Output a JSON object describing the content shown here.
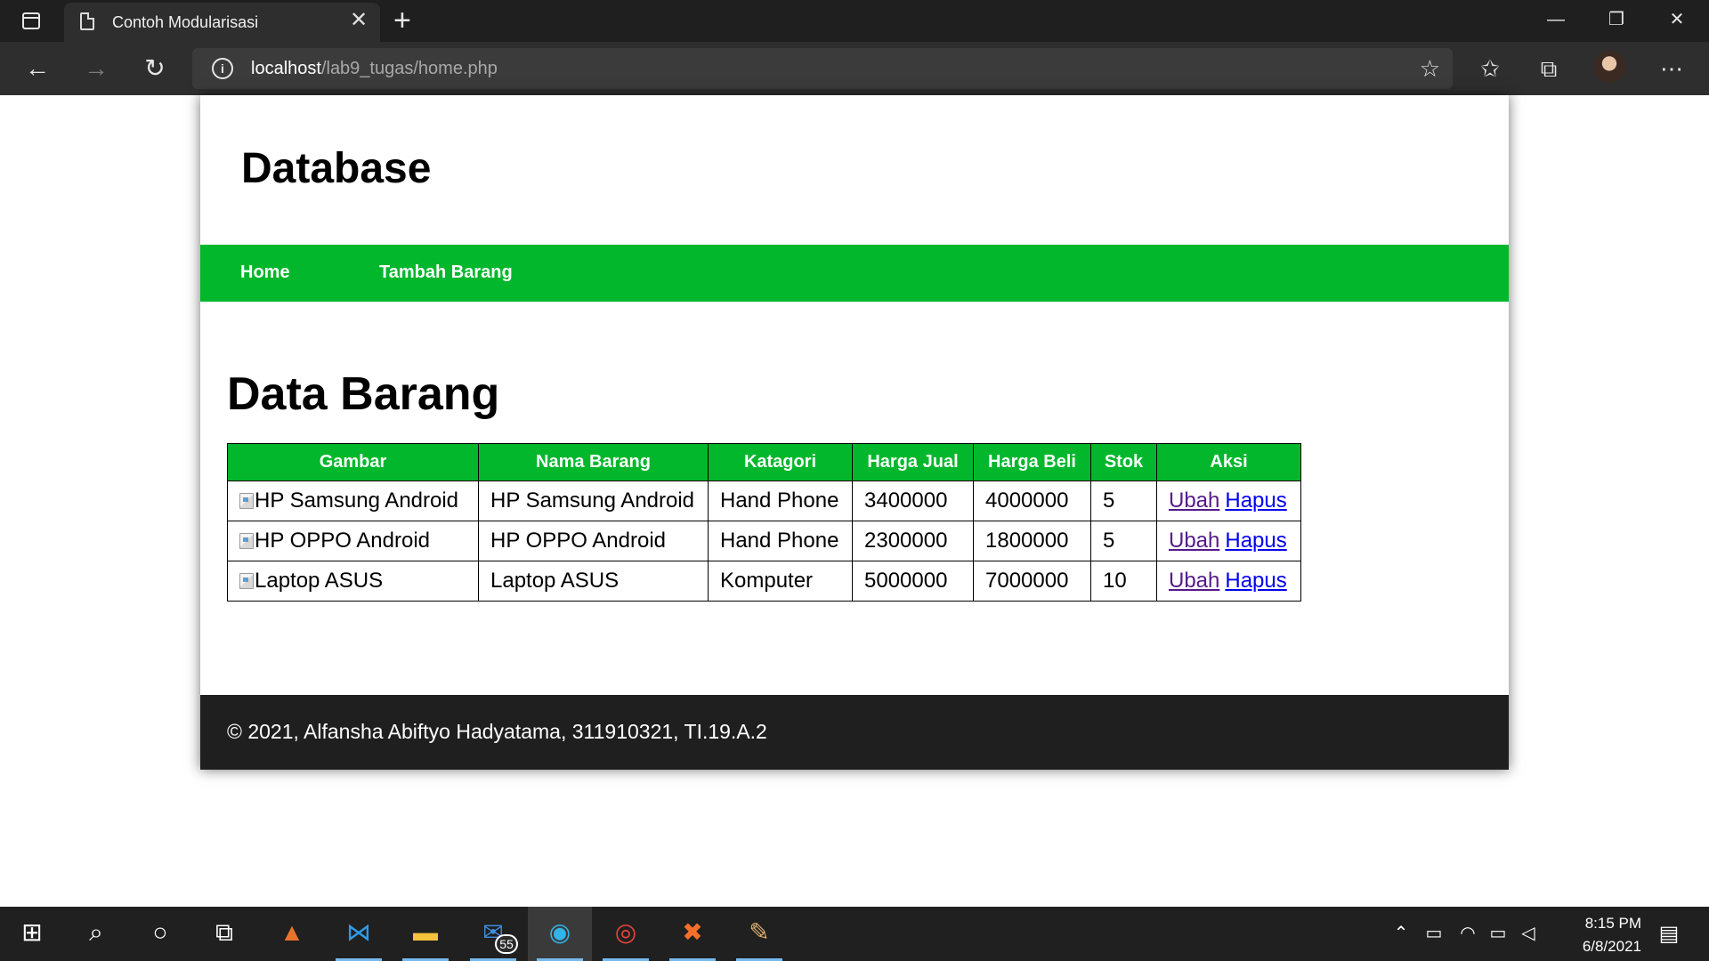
{
  "browser": {
    "tab_title": "Contoh Modularisasi",
    "tab_close": "✕",
    "new_tab": "+",
    "url_host": "localhost",
    "url_path": "/lab9_tugas/home.php",
    "window_controls": {
      "minimize": "—",
      "restore": "❐",
      "close": "✕"
    },
    "icons": {
      "back": "arrow-left-icon",
      "forward": "arrow-right-icon",
      "refresh": "refresh-icon",
      "info": "info-icon",
      "add_favorite": "star-plus-icon",
      "favorites": "favorites-icon",
      "collections": "collections-icon",
      "more": "more-icon"
    }
  },
  "site": {
    "title": "Database",
    "nav": [
      {
        "label": "Home"
      },
      {
        "label": "Tambah Barang"
      }
    ],
    "heading": "Data Barang",
    "table": {
      "headers": [
        "Gambar",
        "Nama Barang",
        "Katagori",
        "Harga Jual",
        "Harga Beli",
        "Stok",
        "Aksi"
      ],
      "rows": [
        {
          "gambar_alt": "HP Samsung Android",
          "nama": "HP Samsung Android",
          "kategori": "Hand Phone",
          "harga_jual": "3400000",
          "harga_beli": "4000000",
          "stok": "5",
          "ubah": "Ubah",
          "hapus": "Hapus"
        },
        {
          "gambar_alt": "HP OPPO Android",
          "nama": "HP OPPO Android",
          "kategori": "Hand Phone",
          "harga_jual": "2300000",
          "harga_beli": "1800000",
          "stok": "5",
          "ubah": "Ubah",
          "hapus": "Hapus"
        },
        {
          "gambar_alt": "Laptop ASUS",
          "nama": "Laptop ASUS",
          "kategori": "Komputer",
          "harga_jual": "5000000",
          "harga_beli": "7000000",
          "stok": "10",
          "ubah": "Ubah",
          "hapus": "Hapus"
        }
      ]
    },
    "footer": "© 2021, Alfansha Abiftyo Hadyatama, 311910321, TI.19.A.2",
    "colors": {
      "accent_green": "#02b72c",
      "footer_bg": "#1f1f1f"
    }
  },
  "taskbar": {
    "apps": [
      "windows-start-icon",
      "search-icon",
      "cortana-icon",
      "task-view-icon",
      "matlab-icon",
      "vscode-icon",
      "file-explorer-icon",
      "mail-icon",
      "edge-icon",
      "chrome-icon",
      "xampp-icon",
      "paint-icon"
    ],
    "mail_badge": "55",
    "time": "8:15 PM",
    "date": "6/8/2021"
  }
}
